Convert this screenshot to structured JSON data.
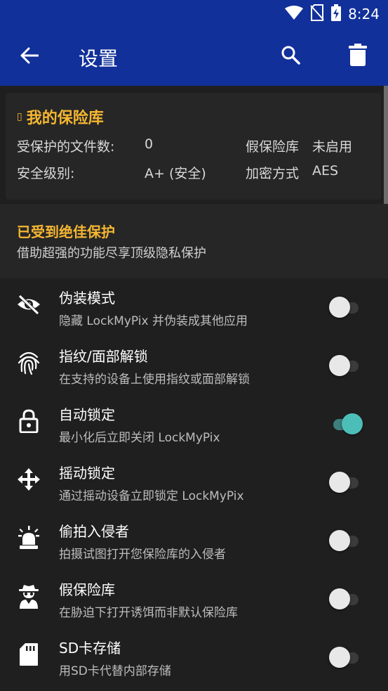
{
  "status_bar": {
    "time": "8:24",
    "icons": [
      "wifi-icon",
      "no-sim-icon",
      "battery-charging-icon"
    ]
  },
  "app_bar": {
    "title": "设置",
    "back_icon": "arrow-back-icon",
    "search_icon": "search-icon",
    "delete_icon": "trash-icon"
  },
  "vault": {
    "title": "我的保险库",
    "title_glyph": "▯",
    "rows": [
      {
        "label": "受保护的文件数:",
        "value": "0",
        "label2": "假保险库",
        "value2": "未启用"
      },
      {
        "label": "安全级别:",
        "value": "A+ (安全)",
        "label2": "加密方式",
        "value2": "AES"
      }
    ]
  },
  "protection": {
    "title": "已受到绝佳保护",
    "subtitle": "借助超强的功能尽享顶级隐私保护"
  },
  "settings": [
    {
      "icon": "eye-off-icon",
      "title": "伪装模式",
      "desc": "隐藏 LockMyPix 并伪装成其他应用",
      "enabled": false
    },
    {
      "icon": "fingerprint-icon",
      "title": "指纹/面部解锁",
      "desc": "在支持的设备上使用指纹或面部解锁",
      "enabled": false
    },
    {
      "icon": "lock-icon",
      "title": "自动锁定",
      "desc": "最小化后立即关闭 LockMyPix",
      "enabled": true
    },
    {
      "icon": "move-arrows-icon",
      "title": "摇动锁定",
      "desc": "通过摇动设备立即锁定 LockMyPix",
      "enabled": false
    },
    {
      "icon": "alarm-light-icon",
      "title": "偷拍入侵者",
      "desc": "拍摄试图打开您保险库的入侵者",
      "enabled": false
    },
    {
      "icon": "spy-icon",
      "title": "假保险库",
      "desc": "在胁迫下打开诱饵而非默认保险库",
      "enabled": false
    },
    {
      "icon": "sd-card-icon",
      "title": "SD卡存储",
      "desc": "用SD卡代替内部存储",
      "enabled": false
    }
  ],
  "colors": {
    "primary": "#12309a",
    "accent": "#f5b731",
    "toggle_on": "#4dbdb7",
    "background": "#1f1f1f",
    "card": "#262626"
  }
}
